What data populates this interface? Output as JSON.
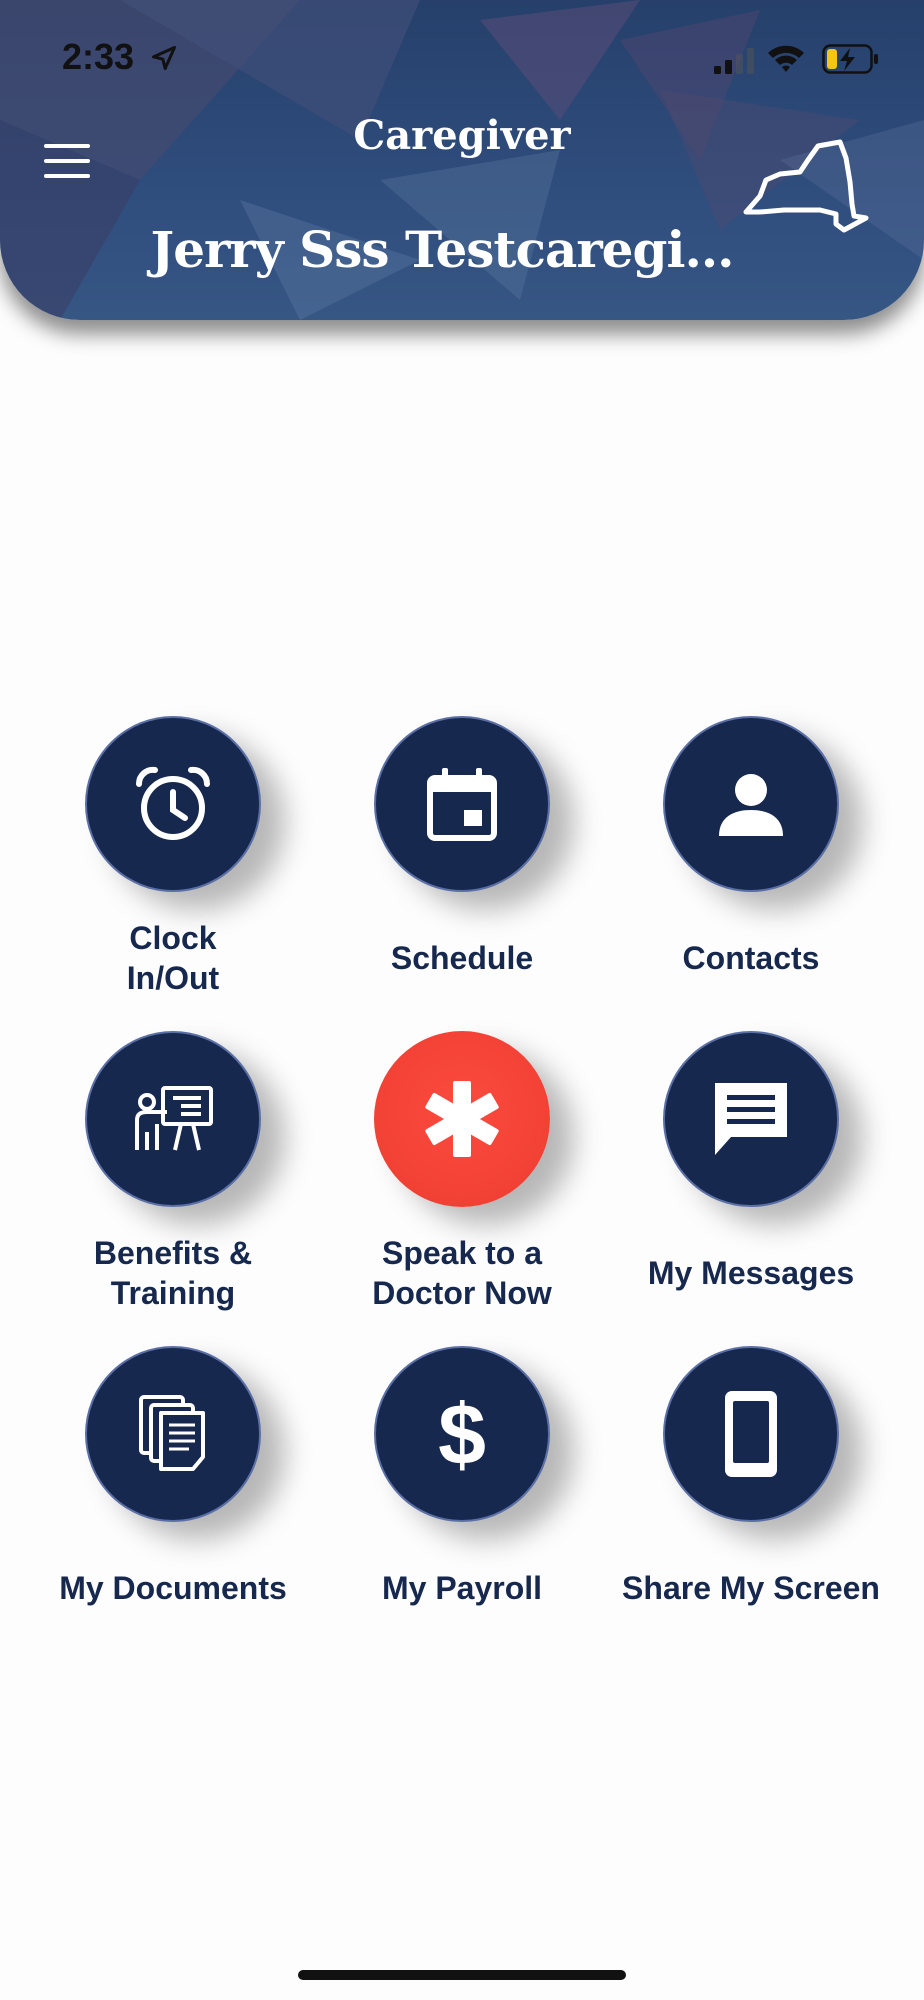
{
  "status_bar": {
    "time": "2:33",
    "location_icon": "location-arrow-icon",
    "signal_icon": "cellular-signal-icon",
    "wifi_icon": "wifi-icon",
    "battery_icon": "battery-charging-icon"
  },
  "header": {
    "app_title": "Caregiver",
    "user_name": "Jerry Sss Testcaregi…",
    "menu_icon": "hamburger-menu-icon",
    "state_icon": "new-york-state-outline-icon",
    "colors": {
      "background": "#2f4d7d",
      "text": "#ffffff"
    }
  },
  "tiles": [
    {
      "label": "Clock\nIn/Out",
      "line1": "Clock",
      "line2": "In/Out",
      "icon": "alarm-clock-icon"
    },
    {
      "label": "Schedule",
      "icon": "calendar-icon"
    },
    {
      "label": "Contacts",
      "icon": "person-icon"
    },
    {
      "line1": "Benefits &",
      "line2": "Training",
      "icon": "presentation-training-icon"
    },
    {
      "line1": "Speak to a",
      "line2": "Doctor Now",
      "icon": "medical-asterisk-icon",
      "color": "#f44336"
    },
    {
      "label": "My Messages",
      "icon": "message-icon"
    },
    {
      "label": "My Documents",
      "icon": "documents-icon"
    },
    {
      "label": "My Payroll",
      "icon": "dollar-icon"
    },
    {
      "label": "Share My Screen",
      "icon": "mobile-phone-icon"
    }
  ],
  "theme": {
    "tile_color": "#17284f",
    "label_color": "#17284f",
    "emergency_color": "#f44336"
  }
}
